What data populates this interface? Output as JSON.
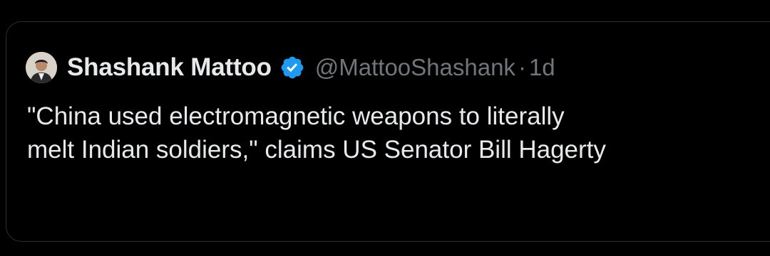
{
  "tweet": {
    "author": {
      "display_name": "Shashank Mattoo",
      "handle": "@MattooShashank",
      "verified": true,
      "verified_badge_color": "#1d9bf0"
    },
    "separator": "·",
    "timestamp": "1d",
    "text_lines": [
      "\"China used electromagnetic weapons to literally",
      "melt Indian soldiers,\" claims US Senator Bill Hagerty"
    ]
  },
  "theme": {
    "background": "#000000",
    "text_primary": "#e7e9ea",
    "text_secondary": "#71767b",
    "border": "#2b2d31"
  }
}
